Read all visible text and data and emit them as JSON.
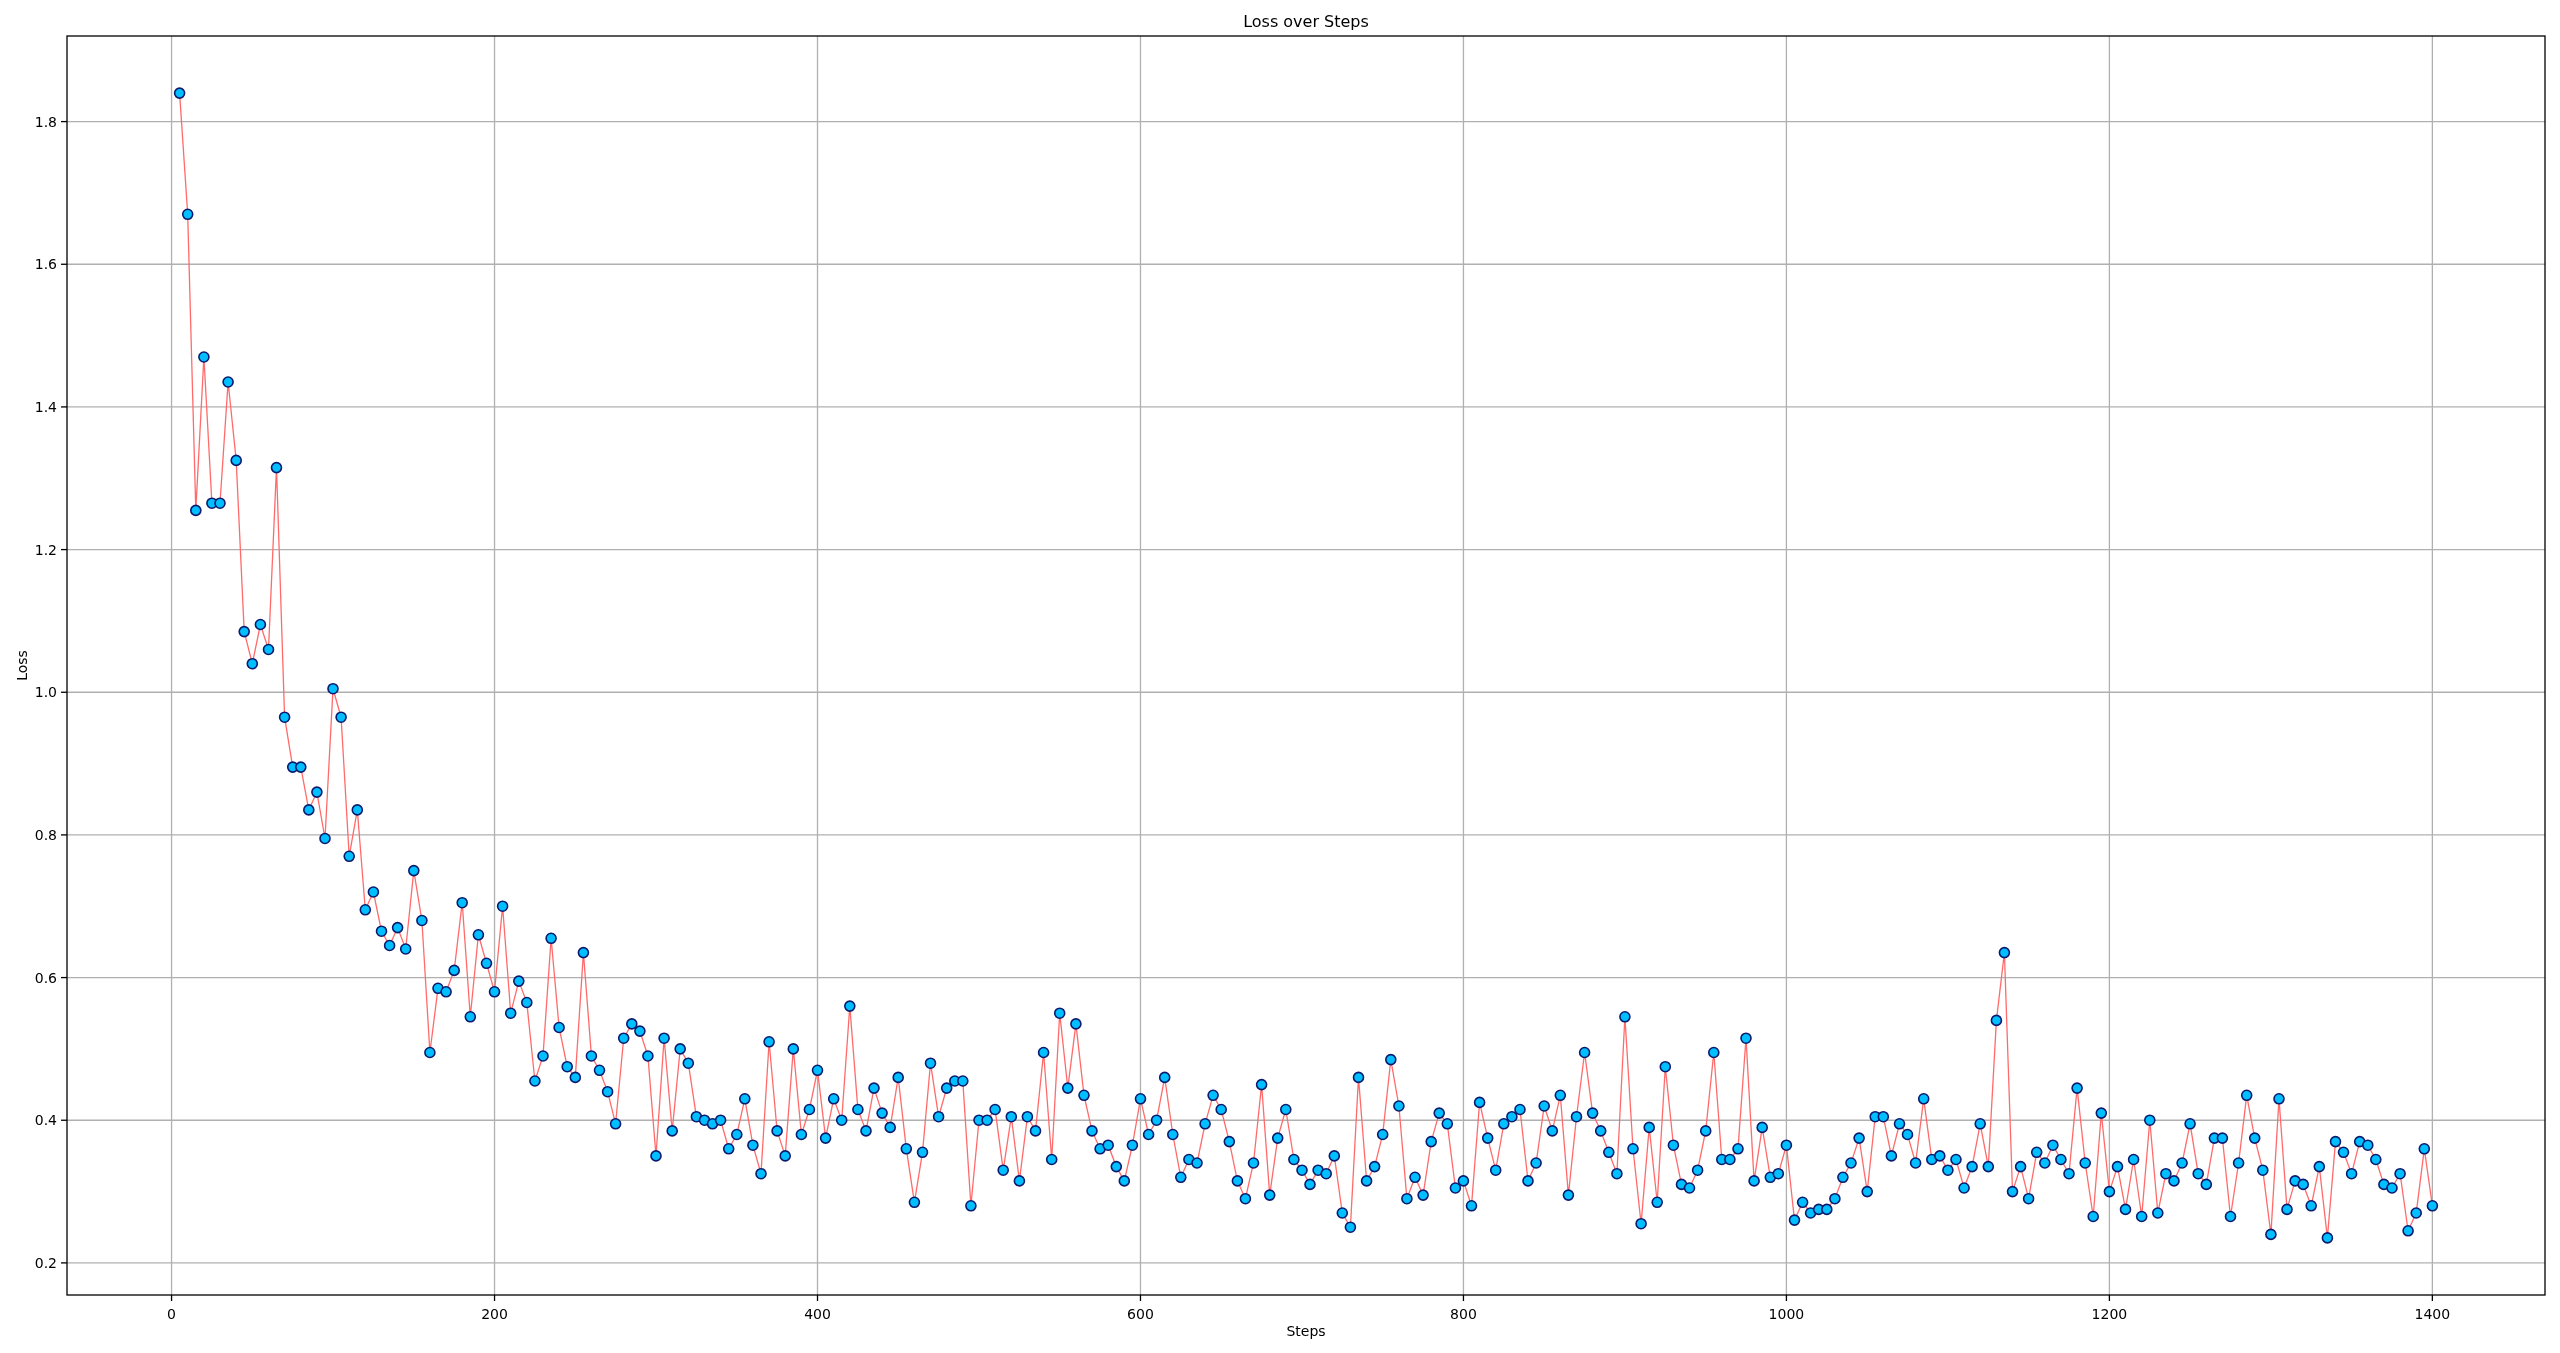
{
  "figure": {
    "chart_data": {
      "type": "line",
      "title": "Loss over Steps",
      "xlabel": "Steps",
      "ylabel": "Loss",
      "grid": true,
      "xlim": [
        -64.75,
        1469.75
      ],
      "ylim": [
        0.155,
        1.92
      ],
      "xticks": [
        0,
        200,
        400,
        600,
        800,
        1000,
        1200,
        1400
      ],
      "yticks": [
        {
          "value": 0.2,
          "label": "0.2"
        },
        {
          "value": 0.4,
          "label": "0.4"
        },
        {
          "value": 0.6,
          "label": "0.6"
        },
        {
          "value": 0.8,
          "label": "0.8"
        },
        {
          "value": 1.0,
          "label": "1.0"
        },
        {
          "value": 1.2,
          "label": "1.2"
        },
        {
          "value": 1.4,
          "label": "1.4"
        },
        {
          "value": 1.6,
          "label": "1.6"
        },
        {
          "value": 1.8,
          "label": "1.8"
        }
      ],
      "x": [
        5,
        10,
        15,
        20,
        25,
        30,
        35,
        40,
        45,
        50,
        55,
        60,
        65,
        70,
        75,
        80,
        85,
        90,
        95,
        100,
        105,
        110,
        115,
        120,
        125,
        130,
        135,
        140,
        145,
        150,
        155,
        160,
        165,
        170,
        175,
        180,
        185,
        190,
        195,
        200,
        205,
        210,
        215,
        220,
        225,
        230,
        235,
        240,
        245,
        250,
        255,
        260,
        265,
        270,
        275,
        280,
        285,
        290,
        295,
        300,
        305,
        310,
        315,
        320,
        325,
        330,
        335,
        340,
        345,
        350,
        355,
        360,
        365,
        370,
        375,
        380,
        385,
        390,
        395,
        400,
        405,
        410,
        415,
        420,
        425,
        430,
        435,
        440,
        445,
        450,
        455,
        460,
        465,
        470,
        475,
        480,
        485,
        490,
        495,
        500,
        505,
        510,
        515,
        520,
        525,
        530,
        535,
        540,
        545,
        550,
        555,
        560,
        565,
        570,
        575,
        580,
        585,
        590,
        595,
        600,
        605,
        610,
        615,
        620,
        625,
        630,
        635,
        640,
        645,
        650,
        655,
        660,
        665,
        670,
        675,
        680,
        685,
        690,
        695,
        700,
        705,
        710,
        715,
        720,
        725,
        730,
        735,
        740,
        745,
        750,
        755,
        760,
        765,
        770,
        775,
        780,
        785,
        790,
        795,
        800,
        805,
        810,
        815,
        820,
        825,
        830,
        835,
        840,
        845,
        850,
        855,
        860,
        865,
        870,
        875,
        880,
        885,
        890,
        895,
        900,
        905,
        910,
        915,
        920,
        925,
        930,
        935,
        940,
        945,
        950,
        955,
        960,
        965,
        970,
        975,
        980,
        985,
        990,
        995,
        1000,
        1005,
        1010,
        1015,
        1020,
        1025,
        1030,
        1035,
        1040,
        1045,
        1050,
        1055,
        1060,
        1065,
        1070,
        1075,
        1080,
        1085,
        1090,
        1095,
        1100,
        1105,
        1110,
        1115,
        1120,
        1125,
        1130,
        1135,
        1140,
        1145,
        1150,
        1155,
        1160,
        1165,
        1170,
        1175,
        1180,
        1185,
        1190,
        1195,
        1200,
        1205,
        1210,
        1215,
        1220,
        1225,
        1230,
        1235,
        1240,
        1245,
        1250,
        1255,
        1260,
        1265,
        1270,
        1275,
        1280,
        1285,
        1290,
        1295,
        1300,
        1305,
        1310,
        1315,
        1320,
        1325,
        1330,
        1335,
        1340,
        1345,
        1350,
        1355,
        1360,
        1365,
        1370,
        1375,
        1380,
        1385,
        1390,
        1395,
        1400
      ],
      "series": [
        {
          "color": "#ff6b6b",
          "marker": "o",
          "values": [
            1.84,
            1.67,
            1.255,
            1.47,
            1.265,
            1.265,
            1.435,
            1.325,
            1.085,
            1.04,
            1.095,
            1.06,
            1.315,
            0.965,
            0.895,
            0.895,
            0.835,
            0.86,
            0.795,
            1.005,
            0.965,
            0.77,
            0.835,
            0.695,
            0.72,
            0.665,
            0.645,
            0.67,
            0.64,
            0.75,
            0.68,
            0.495,
            0.585,
            0.58,
            0.61,
            0.705,
            0.545,
            0.66,
            0.62,
            0.58,
            0.7,
            0.55,
            0.595,
            0.565,
            0.455,
            0.49,
            0.655,
            0.53,
            0.475,
            0.46,
            0.635,
            0.49,
            0.47,
            0.44,
            0.395,
            0.515,
            0.535,
            0.525,
            0.49,
            0.35,
            0.515,
            0.385,
            0.5,
            0.48,
            0.405,
            0.4,
            0.395,
            0.4,
            0.36,
            0.38,
            0.43,
            0.365,
            0.325,
            0.51,
            0.385,
            0.35,
            0.5,
            0.38,
            0.415,
            0.47,
            0.375,
            0.43,
            0.4,
            0.56,
            0.415,
            0.385,
            0.445,
            0.41,
            0.39,
            0.46,
            0.36,
            0.285,
            0.355,
            0.48,
            0.405,
            0.445,
            0.455,
            0.455,
            0.28,
            0.4,
            0.4,
            0.415,
            0.33,
            0.405,
            0.315,
            0.405,
            0.385,
            0.495,
            0.345,
            0.55,
            0.445,
            0.535,
            0.435,
            0.385,
            0.36,
            0.365,
            0.335,
            0.315,
            0.365,
            0.43,
            0.38,
            0.4,
            0.46,
            0.38,
            0.32,
            0.345,
            0.34,
            0.395,
            0.435,
            0.415,
            0.37,
            0.315,
            0.29,
            0.34,
            0.45,
            0.295,
            0.375,
            0.415,
            0.345,
            0.33,
            0.31,
            0.33,
            0.325,
            0.35,
            0.27,
            0.25,
            0.46,
            0.315,
            0.335,
            0.38,
            0.485,
            0.42,
            0.29,
            0.32,
            0.295,
            0.37,
            0.41,
            0.395,
            0.305,
            0.315,
            0.28,
            0.425,
            0.375,
            0.33,
            0.395,
            0.405,
            0.415,
            0.315,
            0.34,
            0.42,
            0.385,
            0.435,
            0.295,
            0.405,
            0.495,
            0.41,
            0.385,
            0.355,
            0.325,
            0.545,
            0.36,
            0.255,
            0.39,
            0.285,
            0.475,
            0.365,
            0.31,
            0.305,
            0.33,
            0.385,
            0.495,
            0.345,
            0.345,
            0.36,
            0.515,
            0.315,
            0.39,
            0.32,
            0.325,
            0.365,
            0.26,
            0.285,
            0.27,
            0.275,
            0.275,
            0.29,
            0.32,
            0.34,
            0.375,
            0.3,
            0.405,
            0.405,
            0.35,
            0.395,
            0.38,
            0.34,
            0.43,
            0.345,
            0.35,
            0.33,
            0.345,
            0.305,
            0.335,
            0.395,
            0.335,
            0.54,
            0.635,
            0.3,
            0.335,
            0.29,
            0.355,
            0.34,
            0.365,
            0.345,
            0.325,
            0.445,
            0.34,
            0.265,
            0.41,
            0.3,
            0.335,
            0.275,
            0.345,
            0.265,
            0.4,
            0.27,
            0.325,
            0.315,
            0.34,
            0.395,
            0.325,
            0.31,
            0.375,
            0.375,
            0.265,
            0.34,
            0.435,
            0.375,
            0.33,
            0.24,
            0.43,
            0.275,
            0.315,
            0.31,
            0.28,
            0.335,
            0.235,
            0.37,
            0.355,
            0.325,
            0.37,
            0.365,
            0.345,
            0.31,
            0.305,
            0.325,
            0.245,
            0.27,
            0.36,
            0.28
          ]
        }
      ]
    }
  }
}
